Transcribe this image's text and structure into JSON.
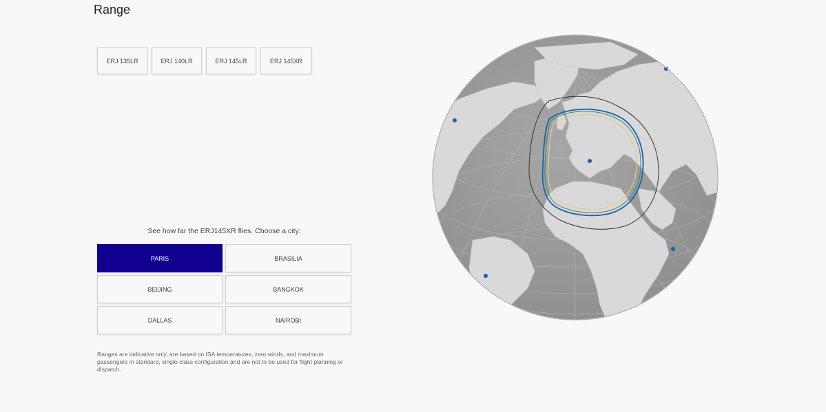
{
  "page": {
    "title": "Range"
  },
  "models": {
    "tabs": [
      {
        "label": "ERJ 135LR"
      },
      {
        "label": "ERJ 140LR"
      },
      {
        "label": "ERJ 145LR"
      },
      {
        "label": "ERJ 145XR"
      }
    ]
  },
  "cities": {
    "prompt": "See how far the ERJ145XR flies. Choose a city:",
    "selected": "PARIS",
    "items": [
      {
        "label": "PARIS",
        "active": true
      },
      {
        "label": "BRASILIA",
        "active": false
      },
      {
        "label": "BEIJING",
        "active": false
      },
      {
        "label": "BANGKOK",
        "active": false
      },
      {
        "label": "DALLAS",
        "active": false
      },
      {
        "label": "NAIROBI",
        "active": false
      }
    ]
  },
  "disclaimer": "Ranges are indicative only, are based on ISA temperatures, zero winds, and maximum passengers in standard, single-class configuration and are not to be used for flight planning or dispatch.",
  "map": {
    "colors": {
      "ocean": "#999999",
      "land": "#d9d9d9",
      "city_marker": "#1a5eb0",
      "range_outer": "#333333",
      "range_blue": "#1d5fa8",
      "range_green": "#2a8a7a",
      "range_yellow": "#e8c98a"
    },
    "city_markers": [
      {
        "name": "Paris"
      },
      {
        "name": "Dallas"
      },
      {
        "name": "Brasilia"
      },
      {
        "name": "Nairobi"
      },
      {
        "name": "Beijing"
      }
    ]
  }
}
